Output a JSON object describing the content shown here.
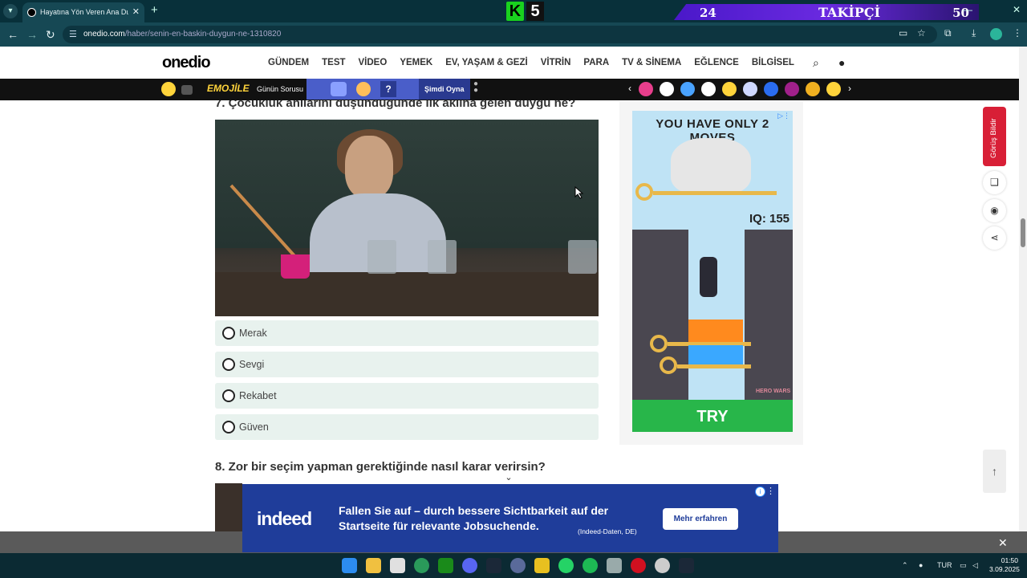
{
  "browser": {
    "tab_title": "Hayatına Yön Veren Ana Duygun",
    "new_tab": "+",
    "url_domain": "onedio.com",
    "url_path": "/haber/senin-en-baskin-duygun-ne-1310820"
  },
  "stream_overlay": {
    "k_letter": "K",
    "k_number": "5",
    "followers_current": "24",
    "followers_label": "TAKİPÇİ",
    "followers_goal": "50"
  },
  "site": {
    "logo": "onedio",
    "nav": [
      "GÜNDEM",
      "TEST",
      "VİDEO",
      "YEMEK",
      "EV, YAŞAM & GEZİ",
      "VİTRİN",
      "PARA",
      "TV & SİNEMA",
      "EĞLENCE",
      "BİLGİSEL"
    ]
  },
  "game_strip": {
    "emojile": "EMOJİLE",
    "daily_question": "Günün Sorusu",
    "question_mark": "?",
    "play_now": "Şimdi Oyna"
  },
  "questions": [
    {
      "title": "7. Çocukluk anılarını düşündüğünde ilk aklına gelen duygu ne?",
      "options": [
        "Merak",
        "Sevgi",
        "Rekabet",
        "Güven"
      ]
    },
    {
      "title": "8. Zor bir seçim yapman gerektiğinde nasıl karar verirsin?"
    }
  ],
  "side_ad": {
    "headline": "YOU HAVE ONLY 2 MOVES",
    "iq": "IQ: 155",
    "cta": "TRY",
    "brand": "HERO WARS"
  },
  "sidebar_actions": {
    "feedback": "Görüş Bildir"
  },
  "bottom_ad": {
    "logo": "indeed",
    "message": "Fallen Sie auf – durch bessere Sichtbarkeit auf der Startseite für relevante Jobsuchende.",
    "source": "(Indeed-Daten, DE)",
    "cta": "Mehr erfahren"
  },
  "taskbar": {
    "language": "TUR",
    "time": "01:50",
    "date": "3.09.2025"
  },
  "colors": {
    "browser_frame": "#08303a",
    "address_bar": "#164854",
    "feedback_red": "#d81f36",
    "indeed_blue": "#1f3d9a",
    "option_bg": "#e8f2ee"
  }
}
